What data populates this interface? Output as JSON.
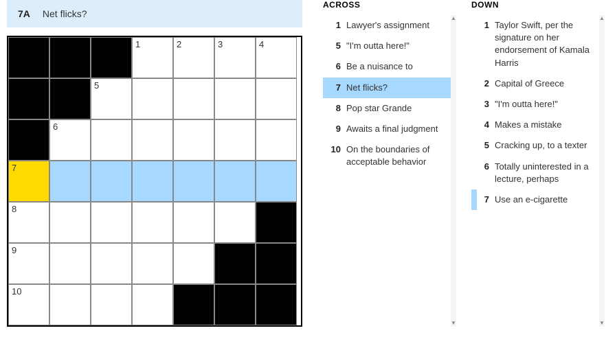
{
  "current_clue": {
    "label": "7A",
    "text": "Net flicks?"
  },
  "grid": {
    "cols": 7,
    "rows": 7,
    "cells": [
      {
        "r": 0,
        "c": 0,
        "black": true
      },
      {
        "r": 0,
        "c": 1,
        "black": true
      },
      {
        "r": 0,
        "c": 2,
        "black": true
      },
      {
        "r": 0,
        "c": 3,
        "num": "1"
      },
      {
        "r": 0,
        "c": 4,
        "num": "2"
      },
      {
        "r": 0,
        "c": 5,
        "num": "3"
      },
      {
        "r": 0,
        "c": 6,
        "num": "4"
      },
      {
        "r": 1,
        "c": 0,
        "black": true
      },
      {
        "r": 1,
        "c": 1,
        "black": true
      },
      {
        "r": 1,
        "c": 2,
        "num": "5"
      },
      {
        "r": 1,
        "c": 3
      },
      {
        "r": 1,
        "c": 4
      },
      {
        "r": 1,
        "c": 5
      },
      {
        "r": 1,
        "c": 6
      },
      {
        "r": 2,
        "c": 0,
        "black": true
      },
      {
        "r": 2,
        "c": 1,
        "num": "6"
      },
      {
        "r": 2,
        "c": 2
      },
      {
        "r": 2,
        "c": 3
      },
      {
        "r": 2,
        "c": 4
      },
      {
        "r": 2,
        "c": 5
      },
      {
        "r": 2,
        "c": 6
      },
      {
        "r": 3,
        "c": 0,
        "num": "7",
        "cursor": true
      },
      {
        "r": 3,
        "c": 1,
        "hl": true
      },
      {
        "r": 3,
        "c": 2,
        "hl": true
      },
      {
        "r": 3,
        "c": 3,
        "hl": true
      },
      {
        "r": 3,
        "c": 4,
        "hl": true
      },
      {
        "r": 3,
        "c": 5,
        "hl": true
      },
      {
        "r": 3,
        "c": 6,
        "hl": true
      },
      {
        "r": 4,
        "c": 0,
        "num": "8"
      },
      {
        "r": 4,
        "c": 1
      },
      {
        "r": 4,
        "c": 2
      },
      {
        "r": 4,
        "c": 3
      },
      {
        "r": 4,
        "c": 4
      },
      {
        "r": 4,
        "c": 5
      },
      {
        "r": 4,
        "c": 6,
        "black": true
      },
      {
        "r": 5,
        "c": 0,
        "num": "9"
      },
      {
        "r": 5,
        "c": 1
      },
      {
        "r": 5,
        "c": 2
      },
      {
        "r": 5,
        "c": 3
      },
      {
        "r": 5,
        "c": 4
      },
      {
        "r": 5,
        "c": 5,
        "black": true
      },
      {
        "r": 5,
        "c": 6,
        "black": true
      },
      {
        "r": 6,
        "c": 0,
        "num": "10"
      },
      {
        "r": 6,
        "c": 1
      },
      {
        "r": 6,
        "c": 2
      },
      {
        "r": 6,
        "c": 3
      },
      {
        "r": 6,
        "c": 4,
        "black": true
      },
      {
        "r": 6,
        "c": 5,
        "black": true
      },
      {
        "r": 6,
        "c": 6,
        "black": true
      }
    ]
  },
  "across": {
    "heading": "ACROSS",
    "clues": [
      {
        "num": "1",
        "text": "Lawyer's assignment"
      },
      {
        "num": "5",
        "text": "\"I'm outta here!\""
      },
      {
        "num": "6",
        "text": "Be a nuisance to"
      },
      {
        "num": "7",
        "text": "Net flicks?",
        "active": true
      },
      {
        "num": "8",
        "text": "Pop star Grande"
      },
      {
        "num": "9",
        "text": "Awaits a final judgment"
      },
      {
        "num": "10",
        "text": "On the boundaries of acceptable behavior"
      }
    ]
  },
  "down": {
    "heading": "DOWN",
    "clues": [
      {
        "num": "1",
        "text": "Taylor Swift, per the signature on her endorsement of Kamala Harris"
      },
      {
        "num": "2",
        "text": "Capital of Greece"
      },
      {
        "num": "3",
        "text": "\"I'm outta here!\""
      },
      {
        "num": "4",
        "text": "Makes a mistake"
      },
      {
        "num": "5",
        "text": "Cracking up, to a texter"
      },
      {
        "num": "6",
        "text": "Totally uninterested in a lecture, perhaps"
      },
      {
        "num": "7",
        "text": "Use an e-cigarette",
        "related": true
      }
    ]
  }
}
